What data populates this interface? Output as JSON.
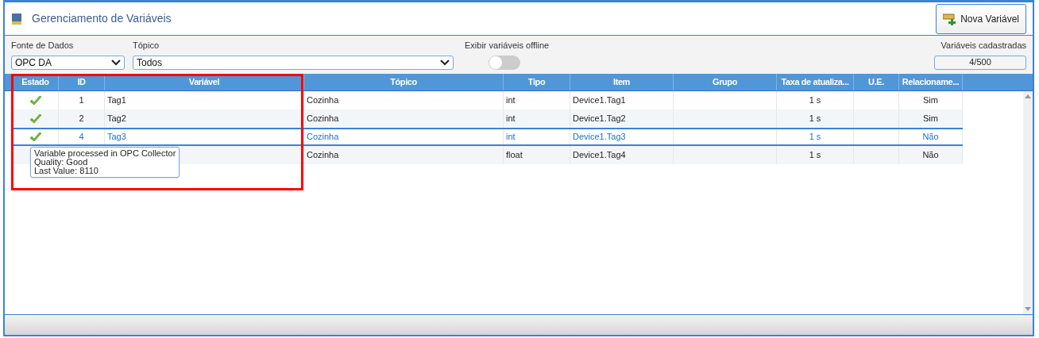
{
  "window": {
    "title": "Gerenciamento de Variáveis"
  },
  "new_button": {
    "label": "Nova Variável"
  },
  "filters": {
    "data_source": {
      "label": "Fonte de Dados",
      "value": "OPC DA"
    },
    "topic": {
      "label": "Tópico",
      "value": "Todos"
    },
    "offline_toggle": {
      "label": "Exibir variáveis offline",
      "on": false
    },
    "count": {
      "label": "Variáveis cadastradas",
      "value": "4/500"
    }
  },
  "table": {
    "columns": [
      "Estado",
      "ID",
      "Variável",
      "Tópico",
      "Tipo",
      "Item",
      "Grupo",
      "Taxa de atualiza...",
      "U.E.",
      "Relacioname..."
    ],
    "rows": [
      {
        "ok": true,
        "selected": false,
        "cells": [
          "",
          "1",
          "Tag1",
          "Cozinha",
          "int",
          "Device1.Tag1",
          "",
          "1 s",
          "",
          "Sim"
        ]
      },
      {
        "ok": true,
        "selected": false,
        "cells": [
          "",
          "2",
          "Tag2",
          "Cozinha",
          "int",
          "Device1.Tag2",
          "",
          "1 s",
          "",
          "Sim"
        ]
      },
      {
        "ok": true,
        "selected": true,
        "cells": [
          "",
          "4",
          "Tag3",
          "Cozinha",
          "int",
          "Device1.Tag3",
          "",
          "1 s",
          "",
          "Não"
        ]
      },
      {
        "selected": false,
        "cells": [
          "",
          "",
          "",
          "Cozinha",
          "float",
          "Device1.Tag4",
          "",
          "1 s",
          "",
          "Não"
        ]
      }
    ]
  },
  "tooltip": {
    "lines": [
      "Variable processed in OPC Collector",
      "Quality: Good",
      "Last Value: 8110"
    ]
  }
}
